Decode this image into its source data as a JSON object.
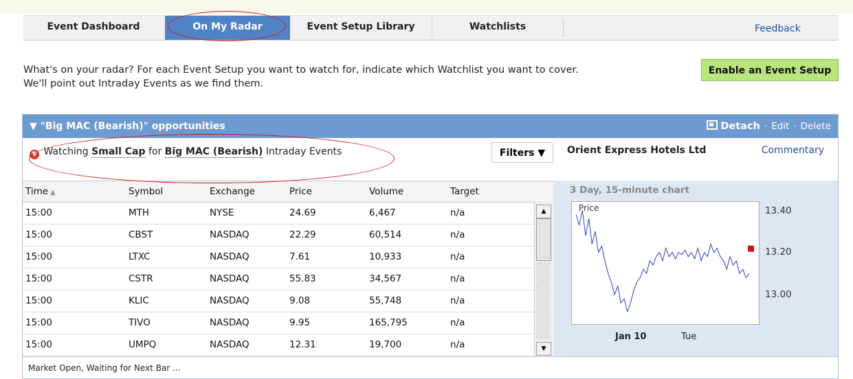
{
  "tabs": [
    {
      "label": "Event Dashboard",
      "active": false
    },
    {
      "label": "On My Radar",
      "active": true
    },
    {
      "label": "Event Setup Library",
      "active": false
    },
    {
      "label": "Watchlists",
      "active": false
    }
  ],
  "feedback_label": "Feedback",
  "intro": {
    "line1": "What's on your radar? For each Event Setup you want to watch for, indicate which Watchlist you want to cover.",
    "line2": "We'll point out Intraday Events as we find them."
  },
  "enable_button": "Enable an Event Setup",
  "panel": {
    "title": "▼ \"Big MAC (Bearish)\" opportunities",
    "detach": "Detach",
    "edit": "Edit",
    "delete": "Delete",
    "watching_prefix": "Watching",
    "watchlist": "Small Cap",
    "for_word": "for",
    "setup": "Big MAC (Bearish)",
    "watching_suffix": "Intraday Events",
    "filters": "Filters ▼"
  },
  "table": {
    "columns": [
      "Time",
      "Symbol",
      "Exchange",
      "Price",
      "Volume",
      "Target"
    ],
    "rows": [
      [
        "15:00",
        "MTH",
        "NYSE",
        "24.69",
        "6,467",
        "n/a"
      ],
      [
        "15:00",
        "CBST",
        "NASDAQ",
        "22.29",
        "60,514",
        "n/a"
      ],
      [
        "15:00",
        "LTXC",
        "NASDAQ",
        "7.61",
        "10,933",
        "n/a"
      ],
      [
        "15:00",
        "CSTR",
        "NASDAQ",
        "55.83",
        "34,567",
        "n/a"
      ],
      [
        "15:00",
        "KLIC",
        "NASDAQ",
        "9.08",
        "55,748",
        "n/a"
      ],
      [
        "15:00",
        "TIVO",
        "NASDAQ",
        "9.95",
        "165,795",
        "n/a"
      ],
      [
        "15:00",
        "UMPQ",
        "NASDAQ",
        "12.31",
        "19,700",
        "n/a"
      ]
    ]
  },
  "status": "Market Open, Waiting for Next Bar ...",
  "side": {
    "company": "Orient Express Hotels Ltd",
    "commentary": "Commentary",
    "chart_title": "3 Day, 15-minute chart",
    "price_label": "Price",
    "y_ticks": [
      "13.40",
      "13.20",
      "13.00"
    ],
    "x_ticks": [
      "Jan 10",
      "Tue"
    ]
  },
  "chart_data": {
    "type": "line",
    "title": "3 Day, 15-minute chart",
    "ylabel": "Price",
    "ylim": [
      12.88,
      13.46
    ],
    "y_ticks": [
      13.4,
      13.2,
      13.0
    ],
    "x_ticks": [
      "Jan 10",
      "Tue"
    ],
    "last_marker": 13.22,
    "series": [
      {
        "values": [
          13.4,
          13.35,
          13.42,
          13.3,
          13.38,
          13.26,
          13.32,
          13.22,
          13.25,
          13.18,
          13.12,
          13.08,
          13.02,
          13.06,
          12.98,
          13.0,
          12.94,
          12.98,
          13.04,
          13.08,
          13.1,
          13.14,
          13.12,
          13.18,
          13.16,
          13.2,
          13.22,
          13.18,
          13.24,
          13.2,
          13.22,
          13.19,
          13.22,
          13.21,
          13.23,
          13.2,
          13.22,
          13.19,
          13.24,
          13.18,
          13.22,
          13.2,
          13.26,
          13.22,
          13.24,
          13.2,
          13.18,
          13.14,
          13.2,
          13.16,
          13.18,
          13.12,
          13.14,
          13.1,
          13.12
        ]
      }
    ]
  }
}
